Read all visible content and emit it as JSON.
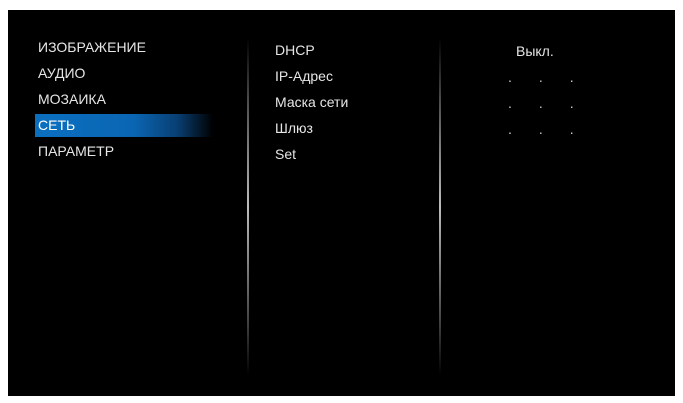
{
  "menu": {
    "items": [
      {
        "label": "ИЗОБРАЖЕНИЕ",
        "selected": false
      },
      {
        "label": "АУДИО",
        "selected": false
      },
      {
        "label": "МОЗАИКА",
        "selected": false
      },
      {
        "label": "СЕТЬ",
        "selected": true
      },
      {
        "label": "ПАРАМЕТР",
        "selected": false
      }
    ]
  },
  "network": {
    "params": [
      {
        "label": "DHCP"
      },
      {
        "label": "IP-Адрес"
      },
      {
        "label": "Маска сети"
      },
      {
        "label": "Шлюз"
      },
      {
        "label": "Set"
      }
    ],
    "values": {
      "dhcp": "Выкл.",
      "ip_address": [
        ".",
        ".",
        "."
      ],
      "subnet_mask": [
        ".",
        ".",
        "."
      ],
      "gateway": [
        ".",
        ".",
        "."
      ]
    }
  },
  "colors": {
    "background": "#000000",
    "text": "#e6e6e6",
    "selected_bg": "#0b6fc0"
  }
}
